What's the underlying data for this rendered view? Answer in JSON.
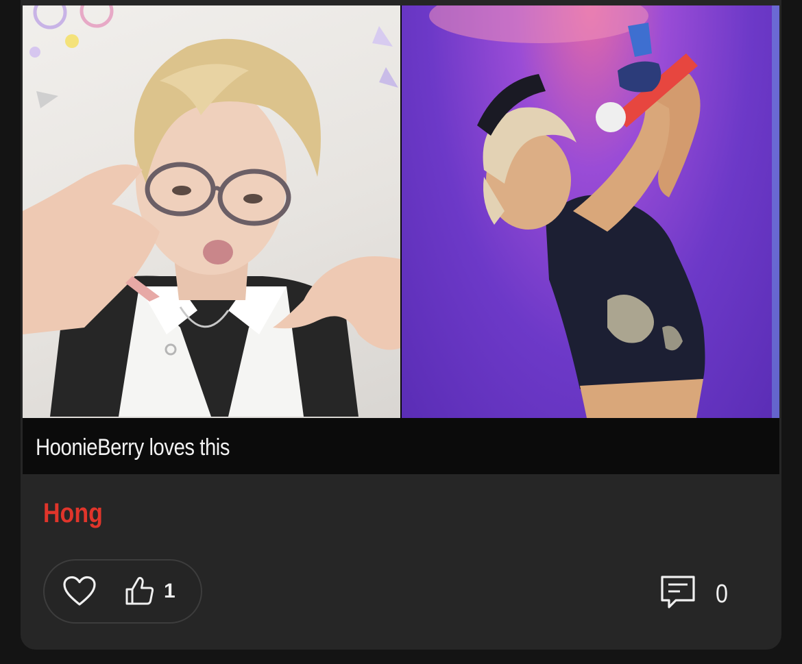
{
  "post": {
    "caption": "HoonieBerry loves this",
    "author": "Hong",
    "author_color": "#e0352b",
    "photos": [
      {
        "name": "selfie-photo"
      },
      {
        "name": "stage-performance-photo"
      }
    ]
  },
  "reactions": {
    "heart_icon": "heart-outline-icon",
    "like_icon": "thumbs-up-outline-icon",
    "like_count": "1"
  },
  "comments": {
    "icon": "comment-icon",
    "count": "0"
  },
  "colors": {
    "page_background": "#141414",
    "card_background": "#262626",
    "caption_background": "#0b0b0b",
    "text": "#f2f2f2"
  }
}
